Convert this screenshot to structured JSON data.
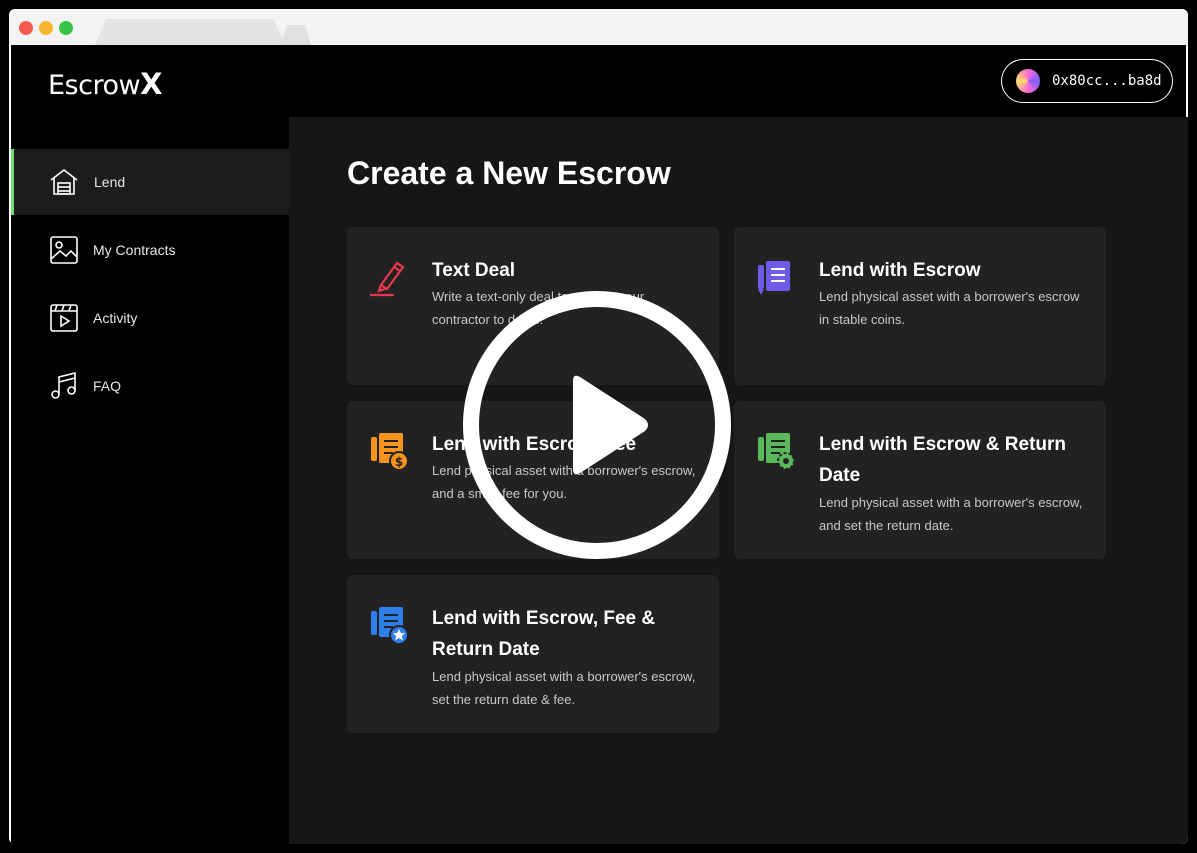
{
  "app": {
    "logo_text": "Escrow",
    "logo_mark": "X"
  },
  "wallet": {
    "address": "0x80cc...ba8d",
    "avatar_icon": "wallet-avatar"
  },
  "sidebar": {
    "items": [
      {
        "label": "Lend",
        "icon": "home-icon",
        "active": true
      },
      {
        "label": "My Contracts",
        "icon": "image-icon",
        "active": false
      },
      {
        "label": "Activity",
        "icon": "video-icon",
        "active": false
      },
      {
        "label": "FAQ",
        "icon": "music-icon",
        "active": false
      }
    ]
  },
  "main": {
    "title": "Create a New Escrow",
    "cards": [
      {
        "title": "Text Deal",
        "desc": "Write a text-only deal to request your contractor to do it...",
        "icon": "pen-icon",
        "color": "#e8384f"
      },
      {
        "title": "Lend with Escrow",
        "desc": "Lend physical asset with a borrower's escrow in stable coins.",
        "icon": "document-icon",
        "color": "#6c5ce7"
      },
      {
        "title": "Lend with Escrow, Fee",
        "desc": "Lend physical asset with a borrower's escrow, and a small fee for you.",
        "icon": "document-dollar-icon",
        "color": "#f7941d"
      },
      {
        "title": "Lend with Escrow & Return Date",
        "desc": "Lend physical asset with a borrower's escrow, and set the return date.",
        "icon": "document-gear-icon",
        "color": "#5cb85c"
      },
      {
        "title": "Lend with Escrow, Fee & Return Date",
        "desc": "Lend physical asset with a borrower's escrow, set the return date & fee.",
        "icon": "document-star-icon",
        "color": "#2f80ed"
      }
    ]
  },
  "overlay": {
    "icon": "play-icon"
  },
  "colors": {
    "accent_active": "#6ee07a",
    "background": "#161616",
    "card": "#222222"
  }
}
